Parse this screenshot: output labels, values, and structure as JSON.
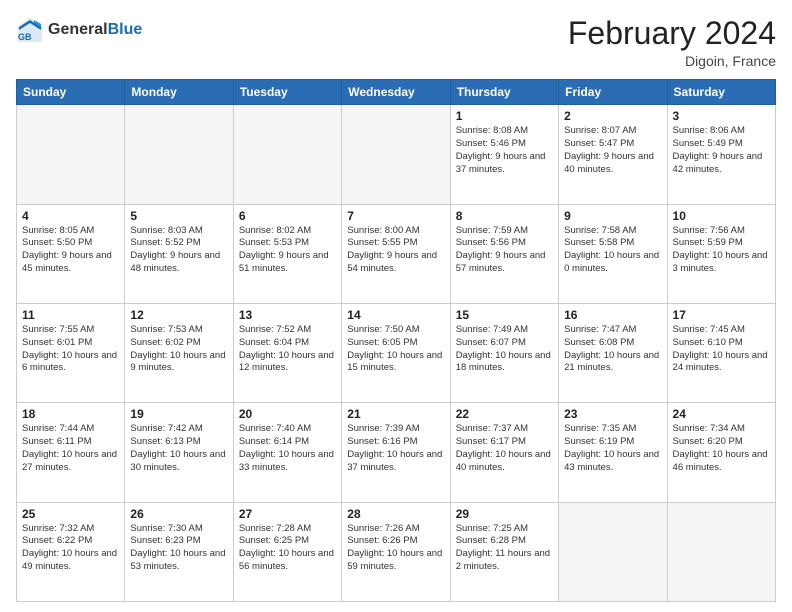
{
  "header": {
    "logo_general": "General",
    "logo_blue": "Blue",
    "title": "February 2024",
    "subtitle": "Digoin, France"
  },
  "days_of_week": [
    "Sunday",
    "Monday",
    "Tuesday",
    "Wednesday",
    "Thursday",
    "Friday",
    "Saturday"
  ],
  "weeks": [
    [
      {
        "day": "",
        "info": ""
      },
      {
        "day": "",
        "info": ""
      },
      {
        "day": "",
        "info": ""
      },
      {
        "day": "",
        "info": ""
      },
      {
        "day": "1",
        "info": "Sunrise: 8:08 AM\nSunset: 5:46 PM\nDaylight: 9 hours\nand 37 minutes."
      },
      {
        "day": "2",
        "info": "Sunrise: 8:07 AM\nSunset: 5:47 PM\nDaylight: 9 hours\nand 40 minutes."
      },
      {
        "day": "3",
        "info": "Sunrise: 8:06 AM\nSunset: 5:49 PM\nDaylight: 9 hours\nand 42 minutes."
      }
    ],
    [
      {
        "day": "4",
        "info": "Sunrise: 8:05 AM\nSunset: 5:50 PM\nDaylight: 9 hours\nand 45 minutes."
      },
      {
        "day": "5",
        "info": "Sunrise: 8:03 AM\nSunset: 5:52 PM\nDaylight: 9 hours\nand 48 minutes."
      },
      {
        "day": "6",
        "info": "Sunrise: 8:02 AM\nSunset: 5:53 PM\nDaylight: 9 hours\nand 51 minutes."
      },
      {
        "day": "7",
        "info": "Sunrise: 8:00 AM\nSunset: 5:55 PM\nDaylight: 9 hours\nand 54 minutes."
      },
      {
        "day": "8",
        "info": "Sunrise: 7:59 AM\nSunset: 5:56 PM\nDaylight: 9 hours\nand 57 minutes."
      },
      {
        "day": "9",
        "info": "Sunrise: 7:58 AM\nSunset: 5:58 PM\nDaylight: 10 hours\nand 0 minutes."
      },
      {
        "day": "10",
        "info": "Sunrise: 7:56 AM\nSunset: 5:59 PM\nDaylight: 10 hours\nand 3 minutes."
      }
    ],
    [
      {
        "day": "11",
        "info": "Sunrise: 7:55 AM\nSunset: 6:01 PM\nDaylight: 10 hours\nand 6 minutes."
      },
      {
        "day": "12",
        "info": "Sunrise: 7:53 AM\nSunset: 6:02 PM\nDaylight: 10 hours\nand 9 minutes."
      },
      {
        "day": "13",
        "info": "Sunrise: 7:52 AM\nSunset: 6:04 PM\nDaylight: 10 hours\nand 12 minutes."
      },
      {
        "day": "14",
        "info": "Sunrise: 7:50 AM\nSunset: 6:05 PM\nDaylight: 10 hours\nand 15 minutes."
      },
      {
        "day": "15",
        "info": "Sunrise: 7:49 AM\nSunset: 6:07 PM\nDaylight: 10 hours\nand 18 minutes."
      },
      {
        "day": "16",
        "info": "Sunrise: 7:47 AM\nSunset: 6:08 PM\nDaylight: 10 hours\nand 21 minutes."
      },
      {
        "day": "17",
        "info": "Sunrise: 7:45 AM\nSunset: 6:10 PM\nDaylight: 10 hours\nand 24 minutes."
      }
    ],
    [
      {
        "day": "18",
        "info": "Sunrise: 7:44 AM\nSunset: 6:11 PM\nDaylight: 10 hours\nand 27 minutes."
      },
      {
        "day": "19",
        "info": "Sunrise: 7:42 AM\nSunset: 6:13 PM\nDaylight: 10 hours\nand 30 minutes."
      },
      {
        "day": "20",
        "info": "Sunrise: 7:40 AM\nSunset: 6:14 PM\nDaylight: 10 hours\nand 33 minutes."
      },
      {
        "day": "21",
        "info": "Sunrise: 7:39 AM\nSunset: 6:16 PM\nDaylight: 10 hours\nand 37 minutes."
      },
      {
        "day": "22",
        "info": "Sunrise: 7:37 AM\nSunset: 6:17 PM\nDaylight: 10 hours\nand 40 minutes."
      },
      {
        "day": "23",
        "info": "Sunrise: 7:35 AM\nSunset: 6:19 PM\nDaylight: 10 hours\nand 43 minutes."
      },
      {
        "day": "24",
        "info": "Sunrise: 7:34 AM\nSunset: 6:20 PM\nDaylight: 10 hours\nand 46 minutes."
      }
    ],
    [
      {
        "day": "25",
        "info": "Sunrise: 7:32 AM\nSunset: 6:22 PM\nDaylight: 10 hours\nand 49 minutes."
      },
      {
        "day": "26",
        "info": "Sunrise: 7:30 AM\nSunset: 6:23 PM\nDaylight: 10 hours\nand 53 minutes."
      },
      {
        "day": "27",
        "info": "Sunrise: 7:28 AM\nSunset: 6:25 PM\nDaylight: 10 hours\nand 56 minutes."
      },
      {
        "day": "28",
        "info": "Sunrise: 7:26 AM\nSunset: 6:26 PM\nDaylight: 10 hours\nand 59 minutes."
      },
      {
        "day": "29",
        "info": "Sunrise: 7:25 AM\nSunset: 6:28 PM\nDaylight: 11 hours\nand 2 minutes."
      },
      {
        "day": "",
        "info": ""
      },
      {
        "day": "",
        "info": ""
      }
    ]
  ]
}
